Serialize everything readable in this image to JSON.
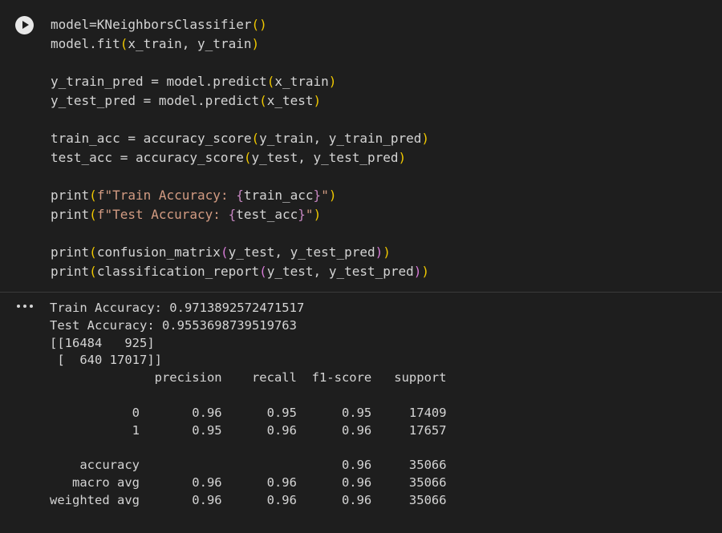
{
  "code_cell": {
    "run_icon": "play-circle-icon",
    "lines": [
      [
        {
          "t": "model=KNeighborsClassifier",
          "c": "default"
        },
        {
          "t": "()",
          "c": "paren1"
        }
      ],
      [
        {
          "t": "model.fit",
          "c": "default"
        },
        {
          "t": "(",
          "c": "paren1"
        },
        {
          "t": "x_train, y_train",
          "c": "default"
        },
        {
          "t": ")",
          "c": "paren1"
        }
      ],
      [],
      [
        {
          "t": "y_train_pred = model.predict",
          "c": "default"
        },
        {
          "t": "(",
          "c": "paren1"
        },
        {
          "t": "x_train",
          "c": "default"
        },
        {
          "t": ")",
          "c": "paren1"
        }
      ],
      [
        {
          "t": "y_test_pred = model.predict",
          "c": "default"
        },
        {
          "t": "(",
          "c": "paren1"
        },
        {
          "t": "x_test",
          "c": "default"
        },
        {
          "t": ")",
          "c": "paren1"
        }
      ],
      [],
      [
        {
          "t": "train_acc = accuracy_score",
          "c": "default"
        },
        {
          "t": "(",
          "c": "paren1"
        },
        {
          "t": "y_train, y_train_pred",
          "c": "default"
        },
        {
          "t": ")",
          "c": "paren1"
        }
      ],
      [
        {
          "t": "test_acc = accuracy_score",
          "c": "default"
        },
        {
          "t": "(",
          "c": "paren1"
        },
        {
          "t": "y_test, y_test_pred",
          "c": "default"
        },
        {
          "t": ")",
          "c": "paren1"
        }
      ],
      [],
      [
        {
          "t": "print",
          "c": "default"
        },
        {
          "t": "(",
          "c": "paren1"
        },
        {
          "t": "f\"Train Accuracy: ",
          "c": "string"
        },
        {
          "t": "{",
          "c": "fbrace"
        },
        {
          "t": "train_acc",
          "c": "default"
        },
        {
          "t": "}",
          "c": "fbrace"
        },
        {
          "t": "\"",
          "c": "string"
        },
        {
          "t": ")",
          "c": "paren1"
        }
      ],
      [
        {
          "t": "print",
          "c": "default"
        },
        {
          "t": "(",
          "c": "paren1"
        },
        {
          "t": "f\"Test Accuracy: ",
          "c": "string"
        },
        {
          "t": "{",
          "c": "fbrace"
        },
        {
          "t": "test_acc",
          "c": "default"
        },
        {
          "t": "}",
          "c": "fbrace"
        },
        {
          "t": "\"",
          "c": "string"
        },
        {
          "t": ")",
          "c": "paren1"
        }
      ],
      [],
      [
        {
          "t": "print",
          "c": "default"
        },
        {
          "t": "(",
          "c": "paren1"
        },
        {
          "t": "confusion_matrix",
          "c": "default"
        },
        {
          "t": "(",
          "c": "paren2"
        },
        {
          "t": "y_test, y_test_pred",
          "c": "default"
        },
        {
          "t": ")",
          "c": "paren2"
        },
        {
          "t": ")",
          "c": "paren1"
        }
      ],
      [
        {
          "t": "print",
          "c": "default"
        },
        {
          "t": "(",
          "c": "paren1"
        },
        {
          "t": "classification_report",
          "c": "default"
        },
        {
          "t": "(",
          "c": "paren2"
        },
        {
          "t": "y_test, y_test_pred",
          "c": "default"
        },
        {
          "t": ")",
          "c": "paren2"
        },
        {
          "t": ")",
          "c": "paren1"
        }
      ]
    ]
  },
  "output": {
    "menu_icon": "more-horizontal-icon",
    "lines": [
      "Train Accuracy: 0.9713892572471517",
      "Test Accuracy: 0.9553698739519763",
      "[[16484   925]",
      " [  640 17017]]",
      "              precision    recall  f1-score   support",
      "",
      "           0       0.96      0.95      0.95     17409",
      "           1       0.95      0.96      0.96     17657",
      "",
      "    accuracy                           0.96     35066",
      "   macro avg       0.96      0.96      0.96     35066",
      "weighted avg       0.96      0.96      0.96     35066"
    ]
  },
  "colors": {
    "background": "#1e1e1e",
    "text": "#d4d4d4",
    "paren_level1": "#f0c800",
    "paren_level2": "#d67bd6",
    "string": "#d29b82",
    "fstring_brace": "#c586c0",
    "run_button": "#e8e8e8"
  }
}
